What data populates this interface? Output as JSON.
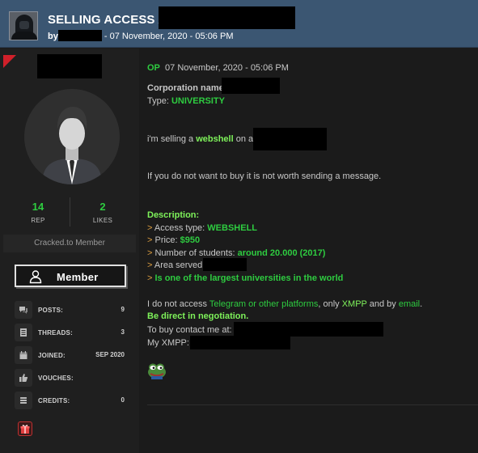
{
  "header": {
    "title": "SELLING ACCESS AT",
    "by_label": "by",
    "timestamp": " - 07 November, 2020 - 05:06 PM"
  },
  "user": {
    "rep_value": "14",
    "rep_label": "REP",
    "likes_value": "2",
    "likes_label": "LIKES",
    "group": "Cracked.to Member",
    "rank_label": "Member",
    "info": [
      {
        "label": "POSTS:",
        "value": "9",
        "icon": "posts-icon"
      },
      {
        "label": "THREADS:",
        "value": "3",
        "icon": "threads-icon"
      },
      {
        "label": "JOINED:",
        "value": "SEP 2020",
        "icon": "calendar-icon"
      },
      {
        "label": "VOUCHES:",
        "value": "",
        "icon": "thumbs-up-icon"
      },
      {
        "label": "CREDITS:",
        "value": "0",
        "icon": "credits-icon"
      }
    ]
  },
  "post": {
    "op_label": "OP",
    "date": "07 November, 2020 - 05:06 PM",
    "corp_label": "Corporation name",
    "type_label": "Type: ",
    "type_value": "UNIVERSITY",
    "selling_pre": "i'm selling a ",
    "selling_item": "webshell",
    "selling_post": " on a",
    "warning": "If you do not want to buy it is not worth sending a message.",
    "description_label": "Description:",
    "access_label": "Access type: ",
    "access_value": "WEBSHELL",
    "price_label": "Price: ",
    "price_value": "$950",
    "students_label": "Number of students: ",
    "students_value": "around 20.000 (2017)",
    "area_label": "Area served:",
    "largest": "Is one of the largest universities in the world",
    "contact_pre": "I do not access ",
    "contact_link1": "Telegram or other platforms",
    "contact_mid": ", only ",
    "contact_link2": "XMPP",
    "contact_mid2": " and by ",
    "contact_link3": "email",
    "contact_end": ".",
    "direct": "Be direct in negotiation.",
    "buy_label": "To buy contact me at:",
    "xmpp_label": "My XMPP:",
    "arrow": "> "
  },
  "colors": {
    "header_bg": "#3b5672",
    "accent_green": "#2ecc40",
    "highlight_green": "#7ef25a",
    "background": "#1b1b1b"
  }
}
